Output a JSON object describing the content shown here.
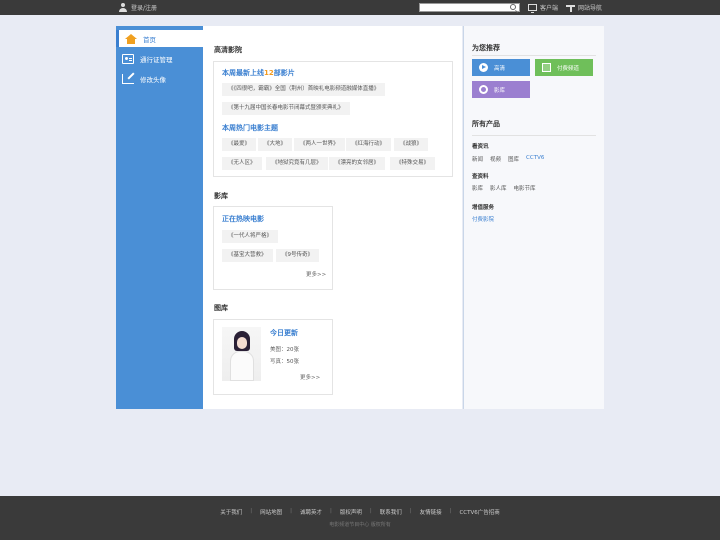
{
  "topbar": {
    "login_label": "登录/注册",
    "search": {
      "placeholder": "",
      "value": ""
    },
    "client_label": "客户端",
    "site_nav_label": "网站导航"
  },
  "sidebar": {
    "items": [
      {
        "label": "首页",
        "icon": "home-icon",
        "active": true
      },
      {
        "label": "通行证管理",
        "icon": "id-card-icon",
        "active": false
      },
      {
        "label": "修改头像",
        "icon": "edit-avatar-icon",
        "active": false
      }
    ]
  },
  "hd_movies": {
    "title": "高清影院",
    "new_weekly": {
      "prefix": "本周最新上线",
      "count": "12",
      "suffix": "部影片"
    },
    "new_tags": [
      "《《四很吧，霸霸》全国（荆州）首映礼电影频道融媒体直播》",
      "《第十九届中国长春电影节闭幕式暨颁奖典礼》"
    ],
    "hot_title": "本周热门电影主题",
    "hot_tags": [
      "《最爱》",
      "《大地》",
      "《两人一世界》",
      "《红海行动》",
      "《战狼》",
      "《无人区》",
      "《地狱究竟有几层》",
      "《漂亮的女邻居》",
      "《特殊交易》"
    ]
  },
  "film_library": {
    "title": "影库",
    "box_title": "正在热映电影",
    "tags": [
      "《一代人将严格》",
      "《基宝大营救》",
      "《9号传奇》"
    ],
    "more_label": "更多>>"
  },
  "gallery": {
    "title": "图库",
    "today_title": "今日更新",
    "rows": [
      {
        "label": "美图：",
        "value": "20张"
      },
      {
        "label": "写真：",
        "value": "50张"
      }
    ],
    "more_label": "更多>>"
  },
  "recommend": {
    "title": "为您推荐",
    "buttons": [
      {
        "label": "高清",
        "icon": "play-icon",
        "color": "#4a8fd6"
      },
      {
        "label": "付费频道",
        "icon": "document-icon",
        "color": "#6fbf5a"
      },
      {
        "label": "影库",
        "icon": "film-reel-icon",
        "color": "#9b7fd0"
      }
    ]
  },
  "products": {
    "title": "所有产品",
    "groups": [
      {
        "name": "看资讯",
        "links": [
          "新闻",
          "视频",
          "图库",
          "CCTV6"
        ]
      },
      {
        "name": "查资料",
        "links": [
          "影库",
          "影人库",
          "电影节库"
        ]
      },
      {
        "name": "增值服务",
        "links": [
          "付费影院"
        ]
      }
    ]
  },
  "footer": {
    "links": [
      "关于我们",
      "网站地图",
      "诚聘英才",
      "版权声明",
      "联系我们",
      "友情链接",
      "CCTV6广告招商"
    ],
    "copyright": "电影频道节目中心 版权所有"
  }
}
